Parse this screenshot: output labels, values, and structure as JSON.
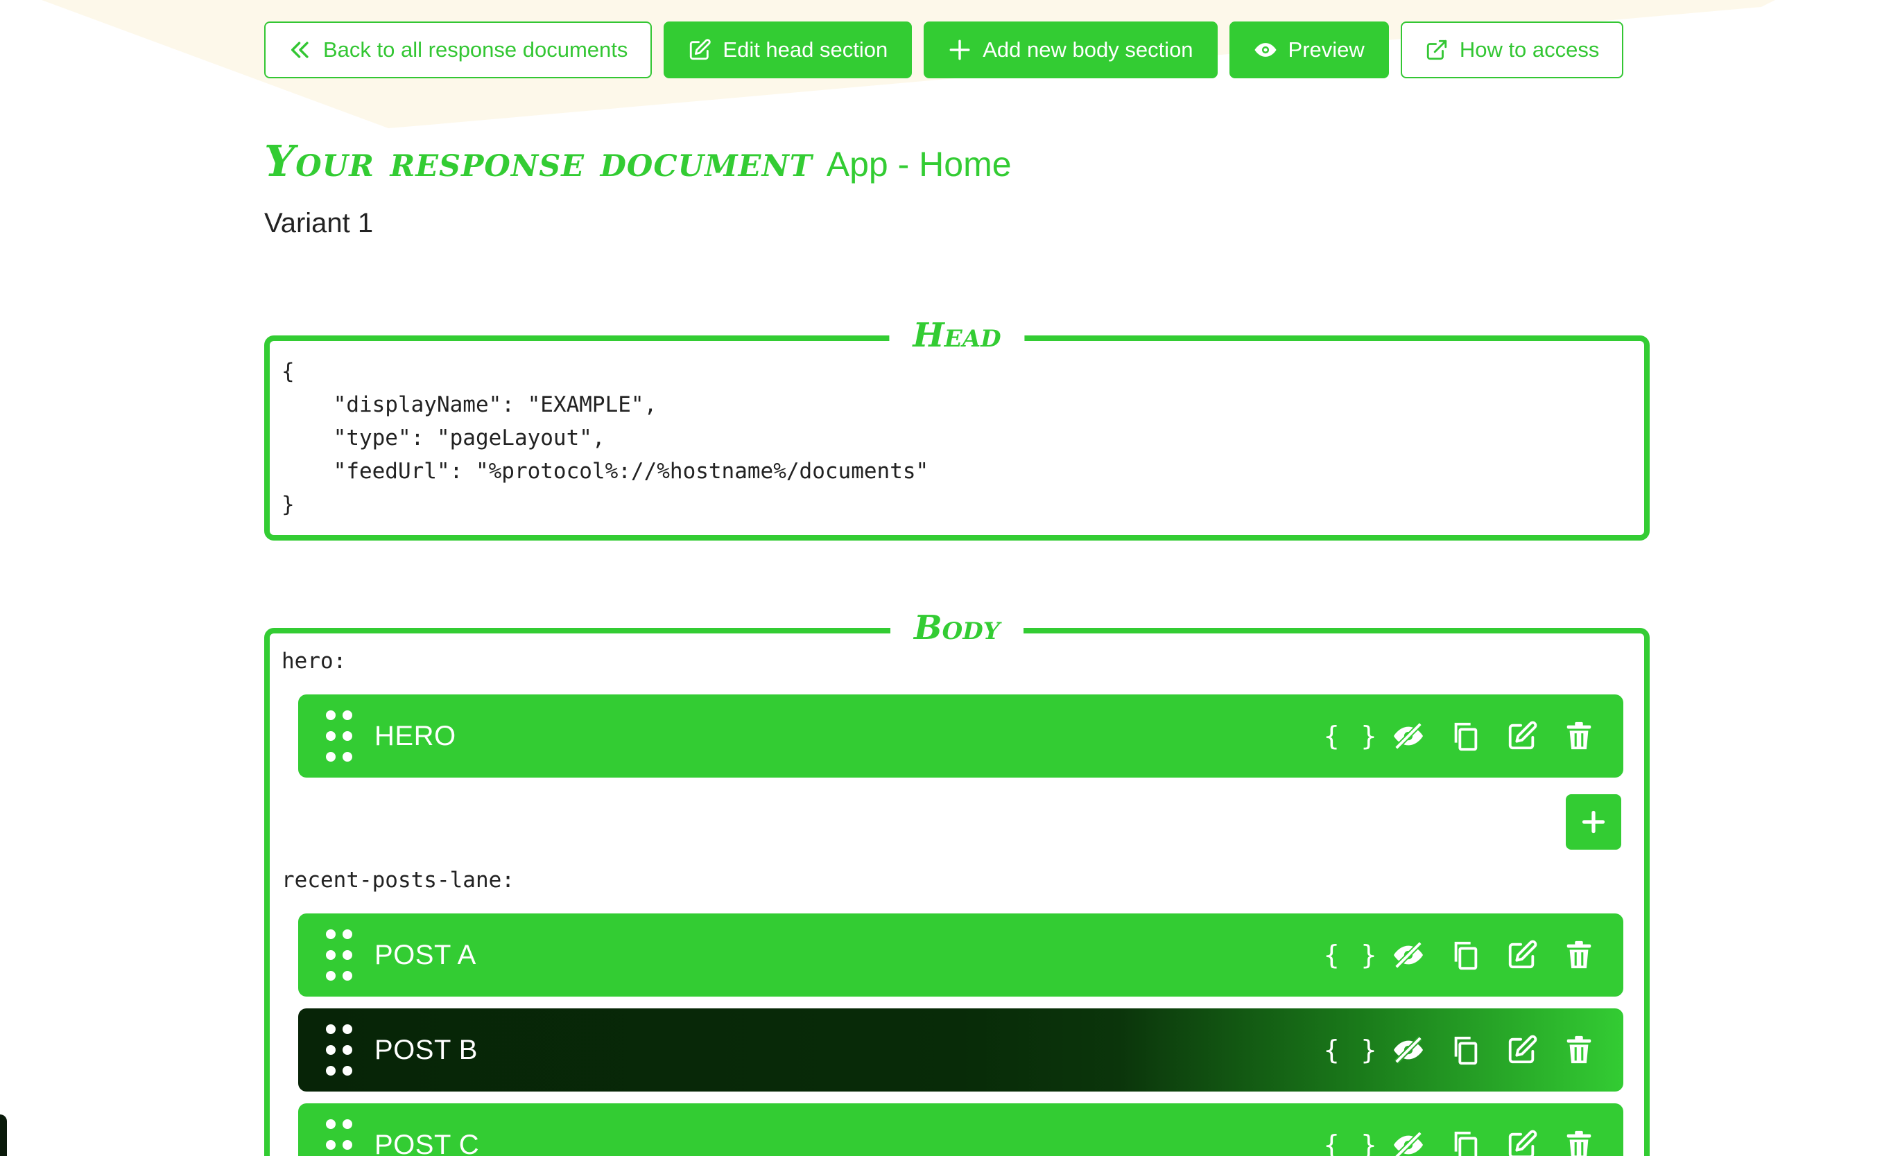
{
  "toolbar": {
    "back_label": "Back to all response documents",
    "edit_head_label": "Edit head section",
    "add_body_label": "Add new body section",
    "preview_label": "Preview",
    "how_to_access_label": "How to access"
  },
  "header": {
    "title": "Your response document",
    "subtitle": "App - Home",
    "variant": "Variant 1"
  },
  "head": {
    "label": "Head",
    "code": "{\n    \"displayName\": \"EXAMPLE\",\n    \"type\": \"pageLayout\",\n    \"feedUrl\": \"%protocol%://%hostname%/documents\"\n}"
  },
  "body": {
    "label": "Body",
    "lanes": [
      {
        "name": "hero:",
        "sections": [
          {
            "name": "HERO"
          }
        ]
      },
      {
        "name": "recent-posts-lane:",
        "sections": [
          {
            "name": "POST A"
          },
          {
            "name": "POST B"
          },
          {
            "name": "POST C"
          }
        ]
      }
    ],
    "json_icon_text": "{ }"
  },
  "colors": {
    "accent": "#33cc33",
    "dark_section": "#072407",
    "text": "#222222",
    "bg_shape": "#fdf8ea"
  },
  "icons": {
    "back": "double-chevron-left-icon",
    "edit": "edit-icon",
    "add": "plus-icon",
    "preview": "eye-icon",
    "external": "external-link-icon",
    "drag": "drag-handle-icon",
    "json": "braces-icon",
    "hide": "eye-slash-icon",
    "copy": "copy-icon",
    "trash": "trash-icon"
  }
}
